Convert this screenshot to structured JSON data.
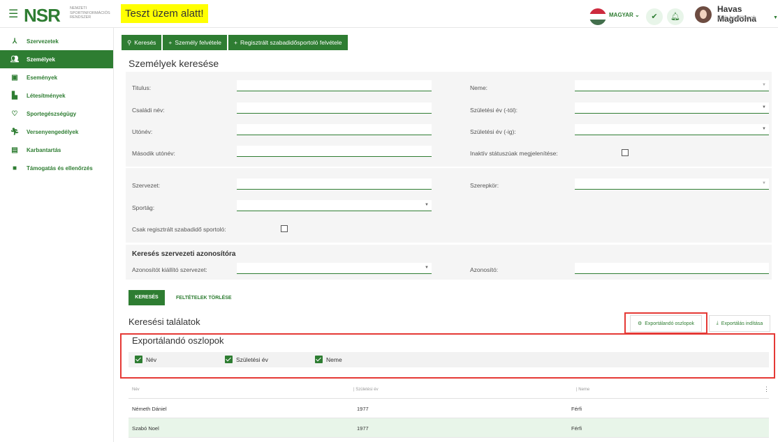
{
  "header": {
    "logo_text": "NSR",
    "logo_subtitle_1": "NEMZETI",
    "logo_subtitle_2": "SPORTINFORMÁCIÓS",
    "logo_subtitle_3": "RENDSZER",
    "test_banner": "Teszt üzem alatt!",
    "language": "MAGYAR",
    "user_name": "Havas Magdolna",
    "user_sub": "Fiók beállítások"
  },
  "sidebar": {
    "items": [
      {
        "label": "Szervezetek",
        "icon": "org-chart-icon"
      },
      {
        "label": "Személyek",
        "icon": "people-icon"
      },
      {
        "label": "Események",
        "icon": "calendar-icon"
      },
      {
        "label": "Létesítmények",
        "icon": "building-icon"
      },
      {
        "label": "Sportegészségügy",
        "icon": "heart-icon"
      },
      {
        "label": "Versenyengedélyek",
        "icon": "runner-icon"
      },
      {
        "label": "Karbantartás",
        "icon": "clipboard-icon"
      },
      {
        "label": "Támogatás és ellenőrzés",
        "icon": "briefcase-icon"
      }
    ],
    "active_index": 1
  },
  "tabs": [
    {
      "label": "Keresés",
      "icon": "search-icon"
    },
    {
      "label": "Személy felvétele",
      "icon": "plus-icon"
    },
    {
      "label": "Regisztrált szabadidősportoló felvétele",
      "icon": "plus-icon"
    }
  ],
  "page_title": "Személyek keresése",
  "form": {
    "titulus": "Titulus:",
    "neme": "Neme:",
    "csaladi_nev": "Családi név:",
    "szuletesi_ev_tol": "Születési év (-tól):",
    "utonev": "Utónév:",
    "szuletesi_ev_ig": "Születési év (-ig):",
    "masodik_utonev": "Második utónév:",
    "inaktiv": "Inaktív státuszúak megjelenítése:",
    "szervezet": "Szervezet:",
    "szerepkor": "Szerepkör:",
    "sportag": "Sportág:",
    "csak_regisztralt": "Csak regisztrált szabadidő sportoló:",
    "section_title": "Keresés szervezeti azonosítóra",
    "azonositot_kiallito": "Azonosítót kiállító szervezet:",
    "azonosito": "Azonosító:"
  },
  "buttons": {
    "search": "KERESÉS",
    "clear": "FELTÉTELEK TÖRLÉSE",
    "export_columns": "Exportálandó oszlopok",
    "export_start": "Exportálás indítása"
  },
  "results_title": "Keresési találatok",
  "export_panel": {
    "title": "Exportálandó oszlopok",
    "options": [
      "Név",
      "Születési év",
      "Neme"
    ]
  },
  "table": {
    "columns": [
      "Név",
      "Születési év",
      "Neme"
    ],
    "rows": [
      [
        "Németh Dániel",
        "1977",
        "Férfi"
      ],
      [
        "Szabó Noel",
        "1977",
        "Férfi"
      ]
    ]
  },
  "colors": {
    "accent": "#2e7d32",
    "highlight": "#e53935",
    "banner": "#ffff00"
  }
}
